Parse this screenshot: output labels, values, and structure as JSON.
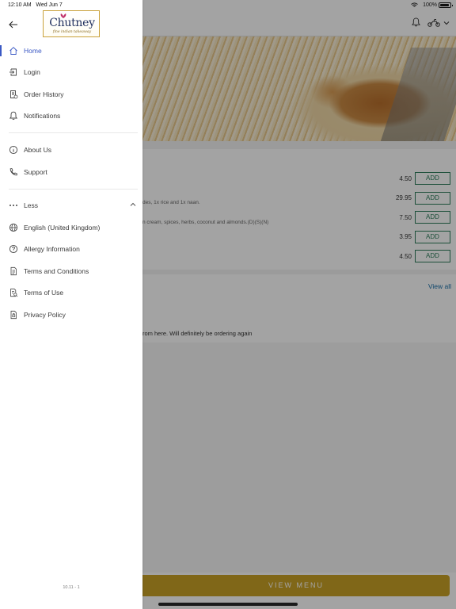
{
  "status_bar": {
    "time": "12:10 AM",
    "date": "Wed Jun 7",
    "battery": "100%"
  },
  "drawer": {
    "logo_text": "Chutney",
    "logo_subtitle": "fine indian takeaway",
    "primary": [
      {
        "label": "Home",
        "icon": "home-icon",
        "active": true
      },
      {
        "label": "Login",
        "icon": "login-icon"
      },
      {
        "label": "Order History",
        "icon": "receipt-icon"
      },
      {
        "label": "Notifications",
        "icon": "bell-icon"
      }
    ],
    "secondary": [
      {
        "label": "About Us",
        "icon": "info-icon"
      },
      {
        "label": "Support",
        "icon": "phone-icon"
      }
    ],
    "less_label": "Less",
    "more": [
      {
        "label": "English (United Kingdom)",
        "icon": "globe-icon"
      },
      {
        "label": "Allergy Information",
        "icon": "question-icon"
      },
      {
        "label": "Terms and Conditions",
        "icon": "document-icon"
      },
      {
        "label": "Terms of Use",
        "icon": "document-search-icon"
      },
      {
        "label": "Privacy Policy",
        "icon": "privacy-icon"
      }
    ],
    "version": "10.11 - 1"
  },
  "background": {
    "menu_items": [
      {
        "price": "4.50",
        "add_label": "ADD",
        "desc": ""
      },
      {
        "price": "29.95",
        "add_label": "ADD",
        "desc": "des, 1x rice and 1x naan."
      },
      {
        "price": "7.50",
        "add_label": "ADD",
        "desc": "n cream, spices, herbs, coconut and almonds.(D)(S)(N)"
      },
      {
        "price": "3.95",
        "add_label": "ADD",
        "desc": ""
      },
      {
        "price": "4.50",
        "add_label": "ADD",
        "desc": ""
      }
    ],
    "view_all": "View all",
    "review_fragment": "rom here. Will definitely be ordering again",
    "view_menu": "VIEW MENU"
  },
  "colors": {
    "accent": "#3b59c4",
    "add_green": "#2e7d5b",
    "view_menu_gold": "#c9a227",
    "logo_navy": "#1d2d5c"
  }
}
